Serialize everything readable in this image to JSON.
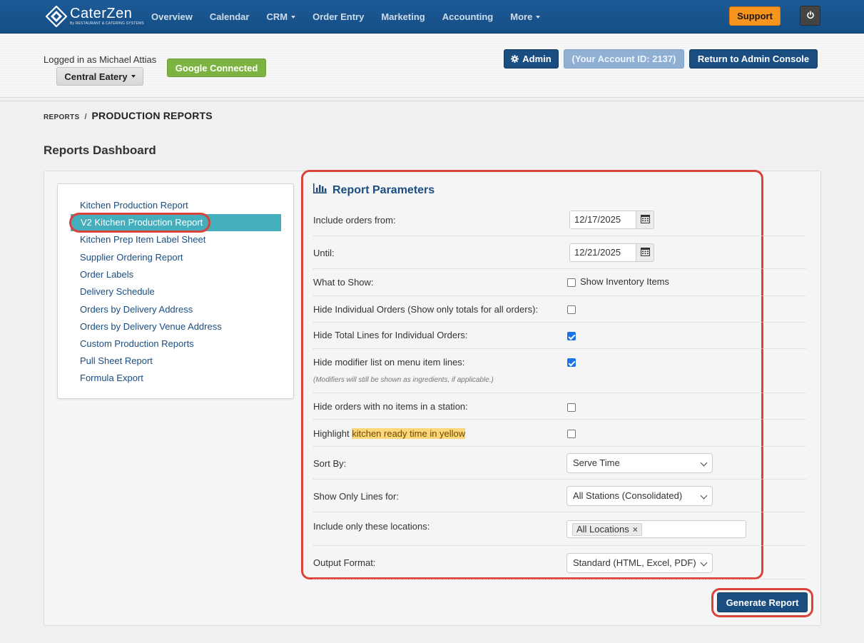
{
  "brand": {
    "name": "CaterZen",
    "tagline": "By RESTAURANT & CATERING SYSTEMS"
  },
  "nav": {
    "items": [
      {
        "label": "Overview",
        "dropdown": false
      },
      {
        "label": "Calendar",
        "dropdown": false
      },
      {
        "label": "CRM",
        "dropdown": true
      },
      {
        "label": "Order Entry",
        "dropdown": false
      },
      {
        "label": "Marketing",
        "dropdown": false
      },
      {
        "label": "Accounting",
        "dropdown": false
      },
      {
        "label": "More",
        "dropdown": true
      }
    ],
    "support_label": "Support",
    "power_icon": "power-icon"
  },
  "account": {
    "logged_in_text": "Logged in as Michael Attias",
    "location_label": "Central Eatery",
    "google_label": "Google Connected",
    "admin_label": "Admin",
    "account_id_label": "(Your Account ID: 2137)",
    "return_label": "Return to Admin Console"
  },
  "breadcrumb": {
    "parent": "REPORTS",
    "separator": "/",
    "current": "PRODUCTION REPORTS"
  },
  "dashboard_title": "Reports Dashboard",
  "sidebar": {
    "items": [
      {
        "label": "Kitchen Production Report",
        "active": false
      },
      {
        "label": "V2 Kitchen Production Report",
        "active": true
      },
      {
        "label": "Kitchen Prep Item Label Sheet",
        "active": false
      },
      {
        "label": "Supplier Ordering Report",
        "active": false
      },
      {
        "label": "Order Labels",
        "active": false
      },
      {
        "label": "Delivery Schedule",
        "active": false
      },
      {
        "label": "Orders by Delivery Address",
        "active": false
      },
      {
        "label": "Orders by Delivery Venue Address",
        "active": false
      },
      {
        "label": "Custom Production Reports",
        "active": false
      },
      {
        "label": "Pull Sheet Report",
        "active": false
      },
      {
        "label": "Formula Export",
        "active": false
      }
    ]
  },
  "params": {
    "title": "Report Parameters",
    "include_from": {
      "label": "Include orders from:",
      "value": "12/17/2025"
    },
    "until": {
      "label": "Until:",
      "value": "12/21/2025"
    },
    "what_to_show": {
      "label": "What to Show:",
      "option_label": "Show Inventory Items",
      "checked": false
    },
    "hide_individual": {
      "label": "Hide Individual Orders (Show only totals for all orders):",
      "checked": false
    },
    "hide_total_lines": {
      "label": "Hide Total Lines for Individual Orders:",
      "checked": true
    },
    "hide_modifier": {
      "label": "Hide modifier list on menu item lines:",
      "checked": true,
      "hint": "(Modifiers will still be shown as ingredients, if applicable.)"
    },
    "hide_no_items": {
      "label": "Hide orders with no items in a station:",
      "checked": false
    },
    "highlight": {
      "label_prefix": "Highlight",
      "label_highlight": "kitchen ready time in yellow",
      "checked": false
    },
    "sort_by": {
      "label": "Sort By:",
      "value": "Serve Time"
    },
    "show_lines_for": {
      "label": "Show Only Lines for:",
      "value": "All Stations (Consolidated)"
    },
    "locations": {
      "label": "Include only these locations:",
      "tag": "All Locations",
      "tag_remove": "×"
    },
    "output_format": {
      "label": "Output Format:",
      "value": "Standard (HTML, Excel, PDF)"
    }
  },
  "generate_label": "Generate Report",
  "colors": {
    "nav_bg": "#1a5490",
    "primary": "#1a4d80",
    "support": "#f7941d",
    "google": "#7cb342",
    "active_item": "#45aebd",
    "annotation": "#d9443a",
    "highlight": "#ffd77a"
  }
}
